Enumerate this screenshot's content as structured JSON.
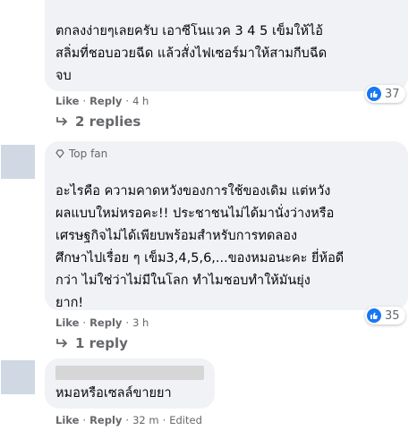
{
  "comments": [
    {
      "lines": [
        "ตกลงง่ายๆเลยครับ เอาซีโนแวค 3 4 5 เข็มให้ไอ้",
        "สลิ่มที่ชอบอวยฉีด แล้วสั่งไฟเซอร์มาให้สามกีบฉีด",
        "จบ"
      ],
      "like_label": "Like",
      "reply_label": "Reply",
      "time": "4 h",
      "reaction_count": "37",
      "replies_label": "2 replies"
    },
    {
      "badge": "Top fan",
      "lines": [
        "อะไรคือ ความคาดหวังของการใช้ของเดิม แต่หวัง",
        "ผลแบบใหม่หรอคะ!! ประชาชนไม่ได้มานั่งว่างหรือ",
        "เศรษฐกิจไม่ได้เพียบพร้อมสำหรับการทดลอง",
        "ศึกษาไปเรื่อย ๆ เข็ม3,4,5,6,...ของหมอนะคะ ยี่ห้อดี",
        "กว่า ไม่ใช่ว่าไม่มีในโลก ทำไมชอบทำให้มันยุ่ง",
        "ยาก!"
      ],
      "like_label": "Like",
      "reply_label": "Reply",
      "time": "3 h",
      "reaction_count": "35",
      "replies_label": "1 reply"
    },
    {
      "lines": [
        "หมอหรือเซลล์ขายยา"
      ],
      "like_label": "Like",
      "reply_label": "Reply",
      "time": "32 m",
      "edited_label": "Edited"
    }
  ],
  "colors": {
    "bubble": "#f0f2f5",
    "like_blue": "#1877f2",
    "meta_gray": "#65676b"
  }
}
